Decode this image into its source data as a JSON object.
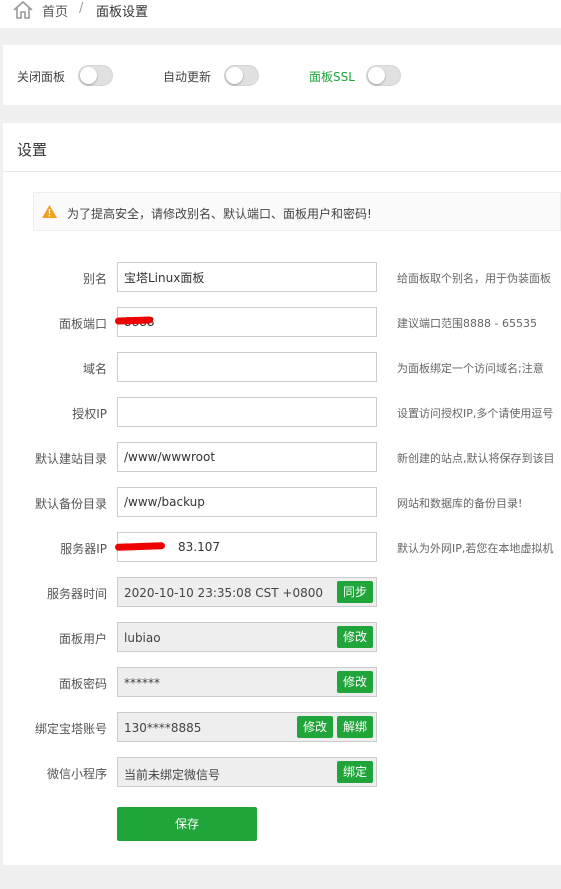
{
  "breadcrumb": {
    "home_icon": "home-icon",
    "home": "首页",
    "separator": "/",
    "current": "面板设置"
  },
  "toggles": [
    {
      "label": "关闭面板",
      "on": false
    },
    {
      "label": "自动更新",
      "on": false
    },
    {
      "label": "面板SSL",
      "on": false,
      "color": "#20a53a"
    }
  ],
  "settings": {
    "title": "设置",
    "alert": {
      "icon": "warning-icon",
      "text": "为了提高安全，请修改别名、默认端口、面板用户和密码!"
    },
    "alias": {
      "label": "别名",
      "value": "宝塔Linux面板",
      "help": "给面板取个别名，用于伪装面板"
    },
    "port": {
      "label": "面板端口",
      "value": "8888",
      "help": "建议端口范围8888 - 65535"
    },
    "domain": {
      "label": "域名",
      "value": "",
      "help": "为面板绑定一个访问域名;注意"
    },
    "auth_ip": {
      "label": "授权IP",
      "value": "",
      "help": "设置访问授权IP,多个请使用逗号"
    },
    "site_dir": {
      "label": "默认建站目录",
      "value": "/www/wwwroot",
      "help": "新创建的站点,默认将保存到该目"
    },
    "backup_dir": {
      "label": "默认备份目录",
      "value": "/www/backup",
      "help": "网站和数据库的备份目录!"
    },
    "server_ip": {
      "label": "服务器IP",
      "value": "83.107",
      "help": "默认为外网IP,若您在本地虚拟机"
    },
    "server_time": {
      "label": "服务器时间",
      "value": "2020-10-10 23:35:08 CST +0800",
      "button": "同步"
    },
    "panel_user": {
      "label": "面板用户",
      "value": "lubiao",
      "button": "修改"
    },
    "panel_pass": {
      "label": "面板密码",
      "value": "******",
      "button": "修改"
    },
    "bt_account": {
      "label": "绑定宝塔账号",
      "value": "130****8885",
      "button_edit": "修改",
      "button_unbind": "解绑"
    },
    "wechat": {
      "label": "微信小程序",
      "value": "当前未绑定微信号",
      "button": "绑定"
    },
    "save": "保存"
  },
  "colors": {
    "accent": "#20a53a",
    "redaction": "#e00000",
    "warning": "#f0a020"
  }
}
